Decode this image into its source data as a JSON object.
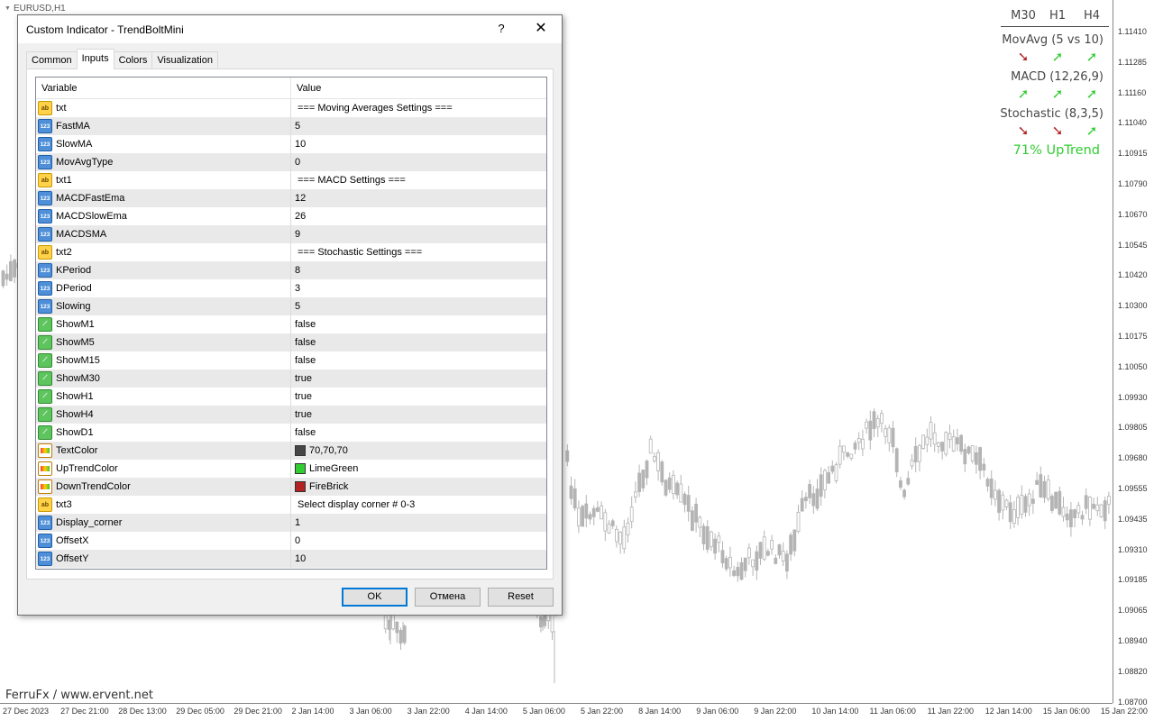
{
  "chart": {
    "symbol": "EURUSD,H1",
    "watermark": "FerruFx / www.ervent.net",
    "price_ticks": [
      "1.11410",
      "1.11285",
      "1.11160",
      "1.11040",
      "1.10915",
      "1.10790",
      "1.10670",
      "1.10545",
      "1.10420",
      "1.10300",
      "1.10175",
      "1.10050",
      "1.09930",
      "1.09805",
      "1.09680",
      "1.09555",
      "1.09435",
      "1.09310",
      "1.09185",
      "1.09065",
      "1.08940",
      "1.08820",
      "1.08700"
    ],
    "time_ticks": [
      "27 Dec 2023",
      "27 Dec 21:00",
      "28 Dec 13:00",
      "29 Dec 05:00",
      "29 Dec 21:00",
      "2 Jan 14:00",
      "3 Jan 06:00",
      "3 Jan 22:00",
      "4 Jan 14:00",
      "5 Jan 06:00",
      "5 Jan 22:00",
      "8 Jan 14:00",
      "9 Jan 06:00",
      "9 Jan 22:00",
      "10 Jan 14:00",
      "11 Jan 06:00",
      "11 Jan 22:00",
      "12 Jan 14:00",
      "15 Jan 06:00",
      "15 Jan 22:00"
    ],
    "candle_color": "#b4b4b4"
  },
  "trend_panel": {
    "timeframes": [
      "M30",
      "H1",
      "H4"
    ],
    "indicators": [
      {
        "name": "MovAvg (5 vs 10)",
        "arrows": [
          "down",
          "up",
          "up"
        ]
      },
      {
        "name": "MACD (12,26,9)",
        "arrows": [
          "up",
          "up",
          "up"
        ]
      },
      {
        "name": "Stochastic (8,3,5)",
        "arrows": [
          "down",
          "down",
          "up"
        ]
      }
    ],
    "summary": "71% UpTrend",
    "up_color": "#32cd32",
    "down_color": "#b22222",
    "text_color": "#464646"
  },
  "dialog": {
    "title": "Custom Indicator - TrendBoltMini",
    "help": "?",
    "close": "✕",
    "tabs": [
      "Common",
      "Inputs",
      "Colors",
      "Visualization"
    ],
    "active_tab": "Inputs",
    "columns": [
      "Variable",
      "Value"
    ],
    "rows": [
      {
        "icon": "string",
        "name": "txt",
        "value": "=== Moving Averages Settings ==="
      },
      {
        "icon": "int",
        "name": "FastMA",
        "value": "5"
      },
      {
        "icon": "int",
        "name": "SlowMA",
        "value": "10"
      },
      {
        "icon": "int",
        "name": "MovAvgType",
        "value": "0"
      },
      {
        "icon": "string",
        "name": "txt1",
        "value": "=== MACD Settings ==="
      },
      {
        "icon": "int",
        "name": "MACDFastEma",
        "value": "12"
      },
      {
        "icon": "int",
        "name": "MACDSlowEma",
        "value": "26"
      },
      {
        "icon": "int",
        "name": "MACDSMA",
        "value": "9"
      },
      {
        "icon": "string",
        "name": "txt2",
        "value": "=== Stochastic Settings ==="
      },
      {
        "icon": "int",
        "name": "KPeriod",
        "value": "8"
      },
      {
        "icon": "int",
        "name": "DPeriod",
        "value": "3"
      },
      {
        "icon": "int",
        "name": "Slowing",
        "value": "5"
      },
      {
        "icon": "bool",
        "name": "ShowM1",
        "value": "false"
      },
      {
        "icon": "bool",
        "name": "ShowM5",
        "value": "false"
      },
      {
        "icon": "bool",
        "name": "ShowM15",
        "value": "false"
      },
      {
        "icon": "bool",
        "name": "ShowM30",
        "value": "true"
      },
      {
        "icon": "bool",
        "name": "ShowH1",
        "value": "true"
      },
      {
        "icon": "bool",
        "name": "ShowH4",
        "value": "true"
      },
      {
        "icon": "bool",
        "name": "ShowD1",
        "value": "false"
      },
      {
        "icon": "color",
        "name": "TextColor",
        "value": "70,70,70",
        "swatch": "#464646"
      },
      {
        "icon": "color",
        "name": "UpTrendColor",
        "value": "LimeGreen",
        "swatch": "#32cd32"
      },
      {
        "icon": "color",
        "name": "DownTrendColor",
        "value": "FireBrick",
        "swatch": "#b22222"
      },
      {
        "icon": "string",
        "name": "txt3",
        "value": "Select display corner # 0-3"
      },
      {
        "icon": "int",
        "name": "Display_corner",
        "value": "1"
      },
      {
        "icon": "int",
        "name": "OffsetX",
        "value": "0"
      },
      {
        "icon": "int",
        "name": "OffsetY",
        "value": "10"
      }
    ],
    "buttons": {
      "ok": "OK",
      "cancel": "Отмена",
      "reset": "Reset"
    }
  }
}
